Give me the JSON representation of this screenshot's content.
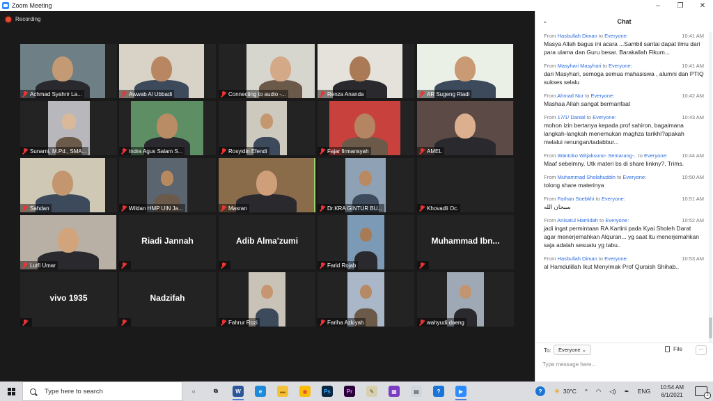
{
  "window": {
    "title": "Zoom Meeting",
    "controls": [
      "–",
      "❐",
      "✕"
    ]
  },
  "recording_label": "Recording",
  "participants": [
    {
      "name": "Achmad Syahrir La...",
      "video": true
    },
    {
      "name": "Awwab Al Ubbadi",
      "video": true
    },
    {
      "name": "Connecting to audio -...",
      "video": true
    },
    {
      "name": "Renza Ananda",
      "video": true
    },
    {
      "name": "AR Sugeng Riadi",
      "video": true
    },
    {
      "name": "Sunarni, M.Pd., SMA...",
      "video": true
    },
    {
      "name": "Indra Agus Salam S...",
      "video": true
    },
    {
      "name": "Rosyidin Efendi",
      "video": true
    },
    {
      "name": "Fajar firmansyah",
      "video": true
    },
    {
      "name": "AMEL",
      "video": true
    },
    {
      "name": "Sahdan",
      "video": true
    },
    {
      "name": "Wildan HMP UIN Ja...",
      "video": true
    },
    {
      "name": "Masran",
      "video": true,
      "active": true
    },
    {
      "name": "Dr.KRA GINTUR BU...",
      "video": true
    },
    {
      "name": "Khovadli Oc.",
      "video": false,
      "display": ""
    },
    {
      "name": "Lutfi Umar",
      "video": true
    },
    {
      "name": "",
      "video": false,
      "display": "Riadi Jannah"
    },
    {
      "name": "",
      "video": false,
      "display": "Adib Alma'zumi"
    },
    {
      "name": "Farid Rojab",
      "video": true
    },
    {
      "name": "",
      "video": false,
      "display": "Muhammad  Ibn..."
    },
    {
      "name": "",
      "video": false,
      "display": "vivo 1935"
    },
    {
      "name": "",
      "video": false,
      "display": "Nadzifah"
    },
    {
      "name": "Fahrur Rozi",
      "video": true
    },
    {
      "name": "Fariha Azkiyah",
      "video": true
    },
    {
      "name": "wahyudi daeng",
      "video": true
    }
  ],
  "chat": {
    "title": "Chat",
    "from_word": "From",
    "to_word": "to",
    "messages": [
      {
        "sender": "Hasbullah Diman",
        "recipient": "Everyone:",
        "time": "10:41 AM",
        "text": "Masya Allah bagus ini acara ...Sambil santai dapat ilmu dari para ulama dan Guru besar. Barakallah Fikum..."
      },
      {
        "sender": "Masyhari Masyhari",
        "recipient": "Everyone:",
        "time": "10:41 AM",
        "text": "dari Masyhari, semoga semua mahasiswa , alumni dan PTIQ sukses selalu"
      },
      {
        "sender": "Ahmad Nur",
        "recipient": "Everyone:",
        "time": "10:42 AM",
        "text": "Mashaa Allah sangat bermanfaat"
      },
      {
        "sender": "17/1/ Danial",
        "recipient": "Everyone:",
        "time": "10:43 AM",
        "text": "mohon izin bertanya kepada prof sahiron, bagaimana langkah-langkah menemukan maghza tarikhi?apakah melalui renungan/tadabbur..."
      },
      {
        "sender": "Wantoko Witjaksono- Semarang-..",
        "recipient": "Everyone:",
        "time": "10:44 AM",
        "text": "Maaf sebelmny. Utk materi bs di share linkny?. Trims."
      },
      {
        "sender": "Muhammad Sholahuddin",
        "recipient": "Everyone:",
        "time": "10:50 AM",
        "text": "tolong share materinya"
      },
      {
        "sender": "Farhan Soebkhi",
        "recipient": "Everyone:",
        "time": "10:51 AM",
        "text": "سبحان الله"
      },
      {
        "sender": "Anisatul Hamidah",
        "recipient": "Everyone:",
        "time": "10:52 AM",
        "text": "jadi ingat permintaan RA Kartini pada Kyai Sholeh Darat agar menerjemahkan Alquran... yg saat itu menerjemahkan saja adalah sesuatu yg tabu.."
      },
      {
        "sender": "Hasbullah Diman",
        "recipient": "Everyone:",
        "time": "10:53 AM",
        "text": "al Hamdulillah Ikut Menyimak Prof Quraish Shihab.."
      }
    ],
    "to_label": "To:",
    "to_value": "Everyone ⌄",
    "file_label": "File",
    "more_label": "···",
    "input_placeholder": "Type message here..."
  },
  "taskbar": {
    "search_text": "Type here to search",
    "apps": [
      {
        "name": "cortana-icon",
        "glyph": "○",
        "color": "transparent",
        "fg": "#111"
      },
      {
        "name": "task-view-icon",
        "glyph": "⧉",
        "color": "transparent",
        "fg": "#111"
      },
      {
        "name": "word-icon",
        "glyph": "W",
        "color": "#2b579a",
        "fg": "#fff",
        "running": true
      },
      {
        "name": "edge-icon",
        "glyph": "e",
        "color": "#1f8ad8",
        "fg": "#fff"
      },
      {
        "name": "file-explorer-icon",
        "glyph": "▬",
        "color": "#f3c13a",
        "fg": "#a36e00"
      },
      {
        "name": "chrome-icon",
        "glyph": "◉",
        "color": "#fbbc05",
        "fg": "#db4437"
      },
      {
        "name": "photoshop-icon",
        "glyph": "Ps",
        "color": "#0b2642",
        "fg": "#31a8ff"
      },
      {
        "name": "premiere-icon",
        "glyph": "Pr",
        "color": "#2a0038",
        "fg": "#e67cff"
      },
      {
        "name": "tool-icon",
        "glyph": "✎",
        "color": "#d7d0b0",
        "fg": "#5a4a10"
      },
      {
        "name": "media-app-icon",
        "glyph": "▦",
        "color": "#7a3cc2",
        "fg": "#fff"
      },
      {
        "name": "printer-app-icon",
        "glyph": "▤",
        "color": "#cfd6de",
        "fg": "#333"
      },
      {
        "name": "help-icon",
        "glyph": "?",
        "color": "#1b74d8",
        "fg": "#fff"
      },
      {
        "name": "zoom-icon",
        "glyph": "▶",
        "color": "#2d8cff",
        "fg": "#fff",
        "running": true
      }
    ],
    "tray": {
      "help": "?",
      "weather": "30°C",
      "chevron": "^",
      "lang": "ENG",
      "time": "10:54 AM",
      "date": "6/1/2021",
      "notif_count": "2"
    }
  }
}
